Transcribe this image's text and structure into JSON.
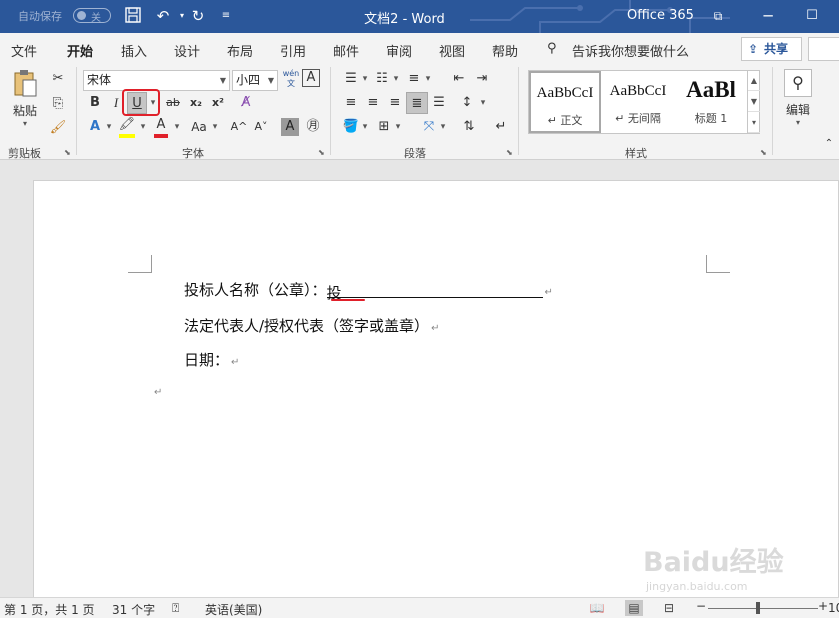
{
  "titlebar": {
    "autosave_label": "自动保存",
    "autosave_state": "关",
    "document_title": "文档2 - Word",
    "office_label": "Office 365"
  },
  "tabs": [
    {
      "label": "文件"
    },
    {
      "label": "开始"
    },
    {
      "label": "插入"
    },
    {
      "label": "设计"
    },
    {
      "label": "布局"
    },
    {
      "label": "引用"
    },
    {
      "label": "邮件"
    },
    {
      "label": "审阅"
    },
    {
      "label": "视图"
    },
    {
      "label": "帮助"
    }
  ],
  "tell_me": "告诉我你想要做什么",
  "share_label": "共享",
  "ribbon": {
    "clipboard": {
      "paste_label": "粘贴",
      "group_label": "剪贴板"
    },
    "font": {
      "font_name": "宋体",
      "font_size": "小四",
      "bold": "B",
      "italic": "I",
      "underline": "U",
      "strike": "ab",
      "subscript": "x₂",
      "superscript": "x²",
      "change_case": "Aa",
      "grow": "A^",
      "shrink": "A˅",
      "char_shade": "A",
      "group_label": "字体"
    },
    "paragraph": {
      "group_label": "段落"
    },
    "styles": {
      "items": [
        {
          "sample": "AaBbCcI",
          "name": "↵ 正文"
        },
        {
          "sample": "AaBbCcI",
          "name": "↵ 无间隔"
        },
        {
          "sample": "AaBl",
          "name": "标题 1"
        }
      ],
      "group_label": "样式"
    },
    "editing": {
      "label": "编辑"
    }
  },
  "document": {
    "lines": [
      {
        "text": "投标人名称（公章）：",
        "field_text": "投"
      },
      {
        "text": "法定代表人/授权代表（签字或盖章）"
      },
      {
        "text": "日期："
      }
    ],
    "paragraph_mark": "↵"
  },
  "statusbar": {
    "page_info": "第 1 页，共 1 页",
    "word_count": "31 个字",
    "language": "英语(美国)",
    "zoom": "10"
  },
  "watermark": {
    "main": "Baidu经验",
    "sub": "jingyan.baidu.com"
  },
  "colors": {
    "title_blue": "#2b579a",
    "annotation_red": "#e0202a",
    "highlight_yellow": "#ffff00",
    "font_color_red": "#e0202a"
  }
}
